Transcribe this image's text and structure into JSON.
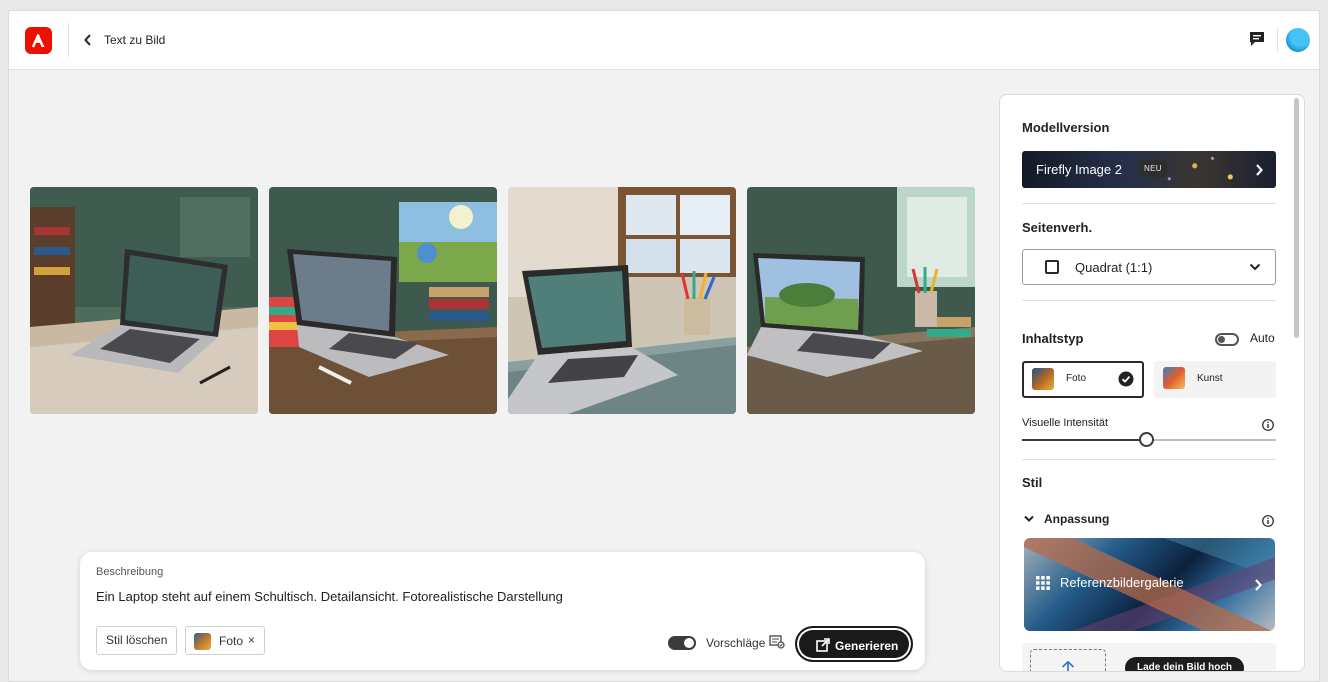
{
  "header": {
    "title": "Text zu Bild",
    "logo_icon": "adobe-logo-icon",
    "back_icon": "chevron-left-icon",
    "feedback_icon": "feedback-icon",
    "avatar_icon": "avatar"
  },
  "images": [
    {
      "label": "Laptop auf Schultisch 1"
    },
    {
      "label": "Laptop auf Schultisch 2"
    },
    {
      "label": "Laptop auf Schultisch 3"
    },
    {
      "label": "Laptop auf Schultisch 4"
    }
  ],
  "prompt": {
    "label": "Beschreibung",
    "text": "Ein Laptop steht auf einem Schultisch. Detailansicht. Fotorealistische Darstellung",
    "clear_style_label": "Stil löschen",
    "chip_label": "Foto",
    "chip_remove": "×",
    "suggestions_label": "Vorschläge",
    "suggestions_on": true,
    "generate_label": "Generieren"
  },
  "panel": {
    "model": {
      "title": "Modellversion",
      "name": "Firefly Image 2",
      "badge": "NEU"
    },
    "aspect": {
      "title": "Seitenverh.",
      "value": "Quadrat (1:1)"
    },
    "content_type": {
      "title": "Inhaltstyp",
      "auto_label": "Auto",
      "auto_on": false,
      "options": [
        {
          "label": "Foto",
          "selected": true
        },
        {
          "label": "Kunst",
          "selected": false
        }
      ]
    },
    "visual_intensity": {
      "label": "Visuelle Intensität",
      "value": 0.49
    },
    "style": {
      "title": "Stil",
      "section_label": "Anpassung",
      "gallery_label": "Referenzbildergalerie",
      "upload_label": "Lade dein Bild hoch"
    }
  },
  "colors": {
    "brand": "#eb1000",
    "primary_button": "#1a1a1a",
    "accent_avatar": "#1c8fd6"
  }
}
